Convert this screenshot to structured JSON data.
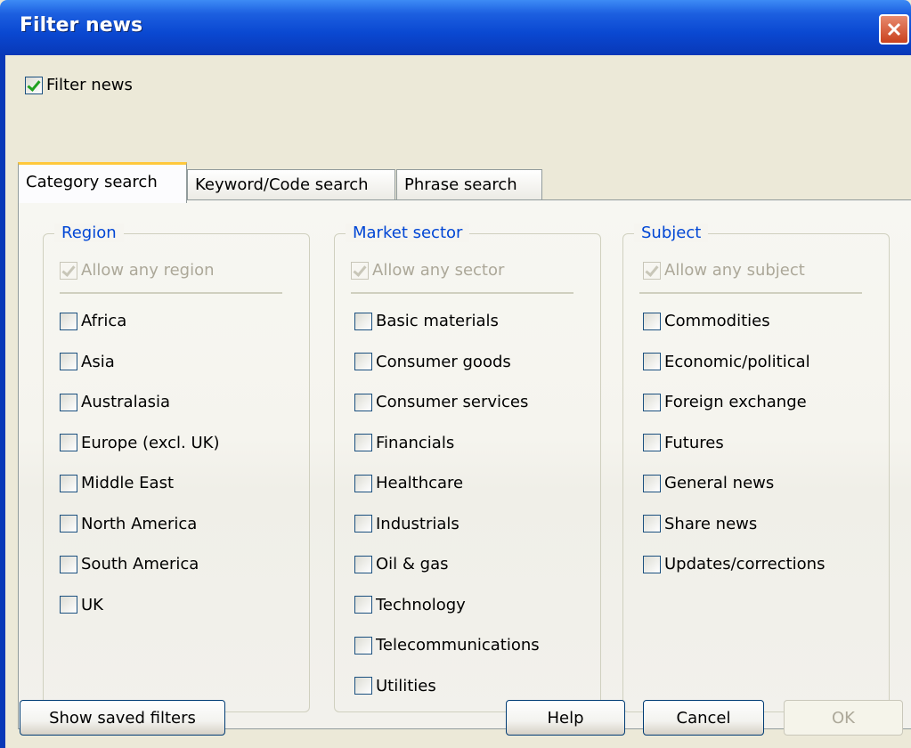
{
  "window": {
    "title": "Filter news"
  },
  "filter_toggle": {
    "label": "Filter news",
    "checked": true
  },
  "tabs": [
    {
      "label": "Category search",
      "active": true
    },
    {
      "label": "Keyword/Code search",
      "active": false
    },
    {
      "label": "Phrase search",
      "active": false
    }
  ],
  "region": {
    "title": "Region",
    "allow_label": "Allow any region",
    "items": [
      "Africa",
      "Asia",
      "Australasia",
      "Europe (excl. UK)",
      "Middle East",
      "North America",
      "South America",
      "UK"
    ]
  },
  "sector": {
    "title": "Market sector",
    "allow_label": "Allow any sector",
    "items": [
      "Basic materials",
      "Consumer goods",
      "Consumer services",
      "Financials",
      "Healthcare",
      "Industrials",
      "Oil & gas",
      "Technology",
      "Telecommunications",
      "Utilities"
    ]
  },
  "subject": {
    "title": "Subject",
    "allow_label": "Allow any subject",
    "items": [
      "Commodities",
      "Economic/political",
      "Foreign exchange",
      "Futures",
      "General news",
      "Share news",
      "Updates/corrections"
    ]
  },
  "buttons": {
    "show_saved": "Show saved filters",
    "help": "Help",
    "cancel": "Cancel",
    "ok": "OK"
  },
  "colors": {
    "accent": "#0046d5",
    "titlebar": "#0a48d1",
    "check": "#21a121"
  }
}
